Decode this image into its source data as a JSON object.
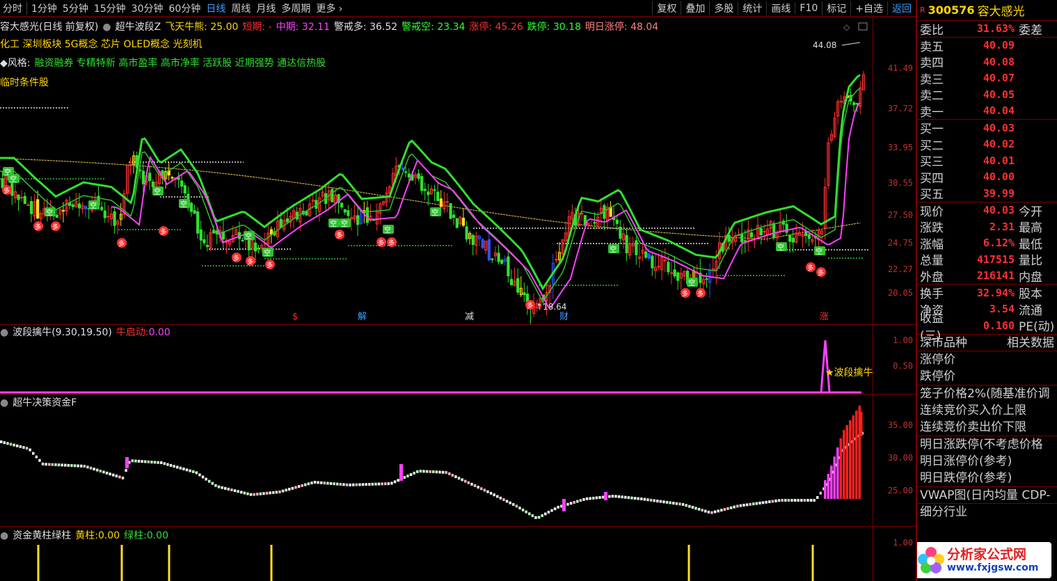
{
  "toolbar": {
    "periods": [
      "分时",
      "1分钟",
      "5分钟",
      "15分钟",
      "30分钟",
      "60分钟",
      "日线",
      "周线",
      "月线",
      "多周期",
      "更多"
    ],
    "active_period": "日线",
    "tools": [
      "复权",
      "叠加",
      "多股",
      "统计",
      "画线",
      "F10",
      "标记",
      "+自选",
      "返回"
    ]
  },
  "main_info": {
    "title": "容大感光(日线 前复权)",
    "indicator": "超牛波段Z",
    "items": [
      {
        "label": "飞天牛熊:",
        "value": "25.00",
        "color": "#ffd700"
      },
      {
        "label": "短期:",
        "value": "-",
        "color": "#ff3030"
      },
      {
        "label": "中期:",
        "value": "32.11",
        "color": "#ff40ff"
      },
      {
        "label": "警戒多:",
        "value": "36.52",
        "color": "#e0e0e0"
      },
      {
        "label": "警戒空:",
        "value": "23.34",
        "color": "#30ff30"
      },
      {
        "label": "涨停:",
        "value": "45.26",
        "color": "#ff3030"
      },
      {
        "label": "跌停:",
        "value": "30.18",
        "color": "#30ff30"
      },
      {
        "label": "明日涨停:",
        "value": "48.04",
        "color": "#ff8080"
      }
    ],
    "concepts": "化工 深圳板块 5G概念 芯片 OLED概念 光刻机",
    "style_label": "◆风格:",
    "styles": "融资融券 专精特新 高市盈率 高市净率 活跃股 近期强势 通达信热股",
    "temp_label": "临时条件股",
    "high_label": "44.08",
    "low_label": "18.64",
    "events": [
      "$",
      "解",
      "减",
      "财",
      "涨"
    ]
  },
  "main_yaxis": [
    "41.49",
    "37.72",
    "33.95",
    "30.55",
    "27.50",
    "24.75",
    "22.27",
    "20.05"
  ],
  "sub1": {
    "title": "波段擒牛(9.30,19.50)",
    "item_label": "牛启动:",
    "item_value": "0.00",
    "signal_label": "★波段擒牛",
    "yaxis": [
      "1.00",
      "0.50"
    ]
  },
  "sub2": {
    "title": "超牛决策资金F",
    "yaxis": [
      "35.00",
      "30.00",
      "25.00"
    ]
  },
  "sub3": {
    "title": "资金黄柱绿柱",
    "yellow_label": "黄柱:",
    "yellow_value": "0.00",
    "green_label": "绿柱:",
    "green_value": "0.00",
    "yaxis": [
      "1.00"
    ]
  },
  "panel": {
    "market_flag": "R",
    "code": "300576",
    "name": "容大感光",
    "webi_label": "委比",
    "webi_value": "31.63%",
    "webi_label2": "委差",
    "asks": [
      {
        "label": "卖五",
        "price": "40.09"
      },
      {
        "label": "卖四",
        "price": "40.08"
      },
      {
        "label": "卖三",
        "price": "40.07"
      },
      {
        "label": "卖二",
        "price": "40.05"
      },
      {
        "label": "卖一",
        "price": "40.04"
      }
    ],
    "bids": [
      {
        "label": "买一",
        "price": "40.03"
      },
      {
        "label": "买二",
        "price": "40.02"
      },
      {
        "label": "买三",
        "price": "40.01"
      },
      {
        "label": "买四",
        "price": "40.00"
      },
      {
        "label": "买五",
        "price": "39.99"
      }
    ],
    "quotes": [
      {
        "label": "现价",
        "value": "40.03",
        "label2": "今开"
      },
      {
        "label": "涨跌",
        "value": "2.31",
        "label2": "最高"
      },
      {
        "label": "涨幅",
        "value": "6.12%",
        "label2": "最低"
      },
      {
        "label": "总量",
        "value": "417515",
        "label2": "量比"
      },
      {
        "label": "外盘",
        "value": "216141",
        "label2": "内盘"
      }
    ],
    "stats": [
      {
        "label": "换手",
        "value": "32.94%",
        "label2": "股本"
      },
      {
        "label": "净资",
        "value": "3.54",
        "label2": "流通"
      },
      {
        "label": "收益(三)",
        "value": "0.160",
        "label2": "PE(动)"
      }
    ],
    "market_type": "深市品种",
    "related": "相关数据",
    "limit_lines": [
      "涨停价",
      "跌停价"
    ],
    "cage_lines": [
      "笼子价格2%(随基准价调",
      "连续竞价买入价上限",
      "连续竞价卖出价下限"
    ],
    "tomorrow_lines": [
      "明日涨跌停(不考虑价格",
      "明日涨停价(参考)",
      "明日跌停价(参考)"
    ],
    "vwap": "VWAP图(日内均量 CDP-",
    "industry": "细分行业"
  },
  "logo": {
    "text": "分析家公式网",
    "url": "www.fxjgsw.com"
  }
}
